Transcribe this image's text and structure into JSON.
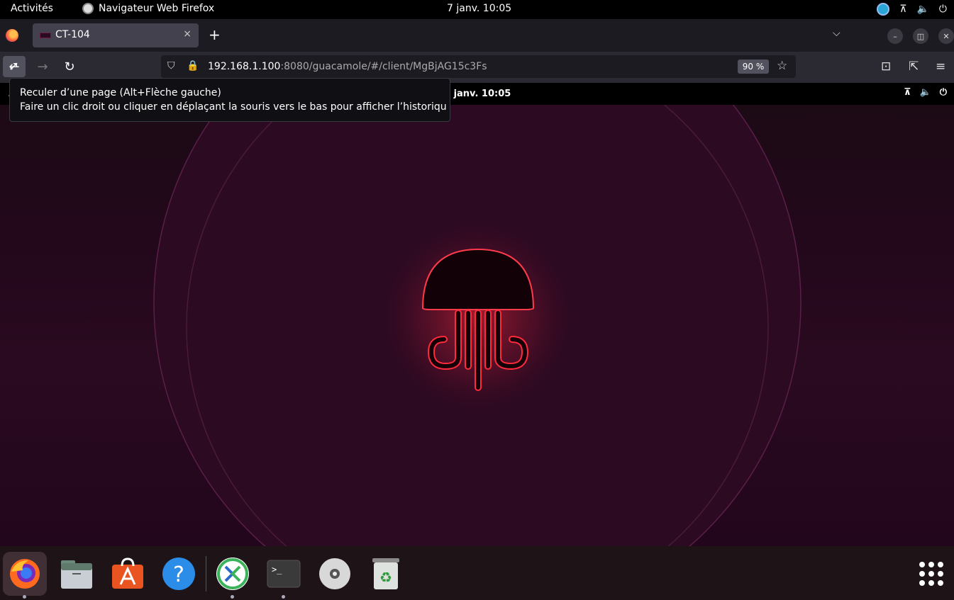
{
  "topbar": {
    "activities": "Activités",
    "app_name": "Navigateur Web Firefox",
    "clock": "7 janv.  10:05"
  },
  "browser": {
    "tab_title": "CT-104",
    "tab_close": "×",
    "new_tab": "+",
    "url_host": "192.168.1.100",
    "url_rest": ":8080/guacamole/#/client/MgBjAG15c3Fs",
    "zoom": "90 %"
  },
  "remote": {
    "activities": "Ac",
    "clock": "7 janv.  10:05"
  },
  "tooltip": {
    "line1": "Reculer d’une page (Alt+Flèche gauche)",
    "line2": "Faire un clic droit ou cliquer en déplaçant la souris vers le bas pour afficher l’historiqu"
  },
  "icons": {
    "back": "←",
    "forward": "→",
    "reload": "↻",
    "shield": "⛉",
    "lock": "🔓",
    "star": "☆",
    "pocket": "⛉",
    "extensions": "⇱",
    "menu": "≡"
  },
  "colors": {
    "accent": "#e0304a",
    "wallpaper": "#24081c"
  }
}
